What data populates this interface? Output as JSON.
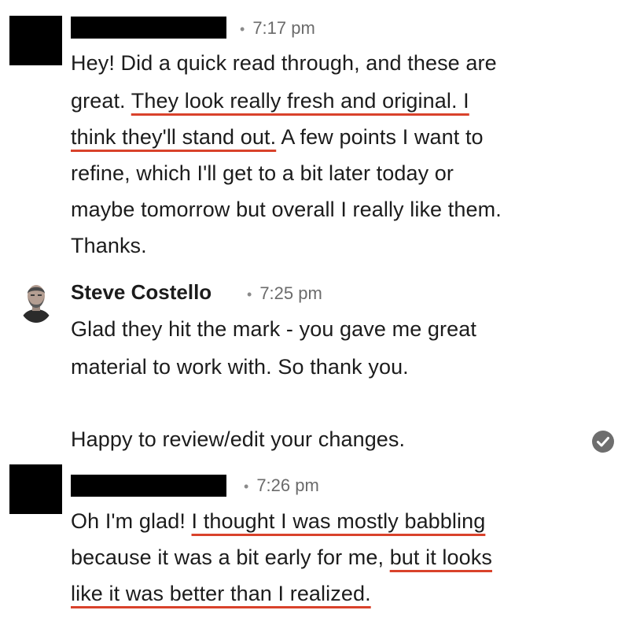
{
  "messages": [
    {
      "time": "7:17 pm",
      "sender_redacted": true,
      "lines": [
        [
          {
            "t": "Hey! Did a quick read through, and these are"
          }
        ],
        [
          {
            "t": "great. "
          },
          {
            "t": "They look really fresh and original. I",
            "hl": true
          }
        ],
        [
          {
            "t": "think they'll stand out.",
            "hl": true
          },
          {
            "t": " A few points I want to"
          }
        ],
        [
          {
            "t": "refine, which I'll get to a bit later today or"
          }
        ],
        [
          {
            "t": "maybe tomorrow but overall I really like them."
          }
        ],
        [
          {
            "t": "Thanks."
          }
        ]
      ]
    },
    {
      "sender": "Steve Costello",
      "time": "7:25 pm",
      "lines": [
        [
          {
            "t": "Glad they hit the mark - you gave me great"
          }
        ],
        [
          {
            "t": "material to work with. So thank you."
          }
        ],
        [
          {
            "t": ""
          }
        ],
        [
          {
            "t": "Happy to review/edit your changes."
          }
        ]
      ],
      "status_icon": "check-circle-icon"
    },
    {
      "time": "7:26 pm",
      "sender_redacted": true,
      "lines": [
        [
          {
            "t": "Oh I'm glad! "
          },
          {
            "t": "I thought I was mostly babbling",
            "hl": true
          }
        ],
        [
          {
            "t": "because it was a bit early for me, "
          },
          {
            "t": "but it looks",
            "hl": true
          }
        ],
        [
          {
            "t": "like it was better than I realized.",
            "hl": true
          }
        ]
      ]
    }
  ],
  "meta_separator": "•",
  "colors": {
    "highlight_underline": "#d9422b",
    "text": "#1c1c1c",
    "timestamp": "#6b6b6b",
    "redaction": "#000000",
    "check_icon": "#6e6e6e"
  }
}
